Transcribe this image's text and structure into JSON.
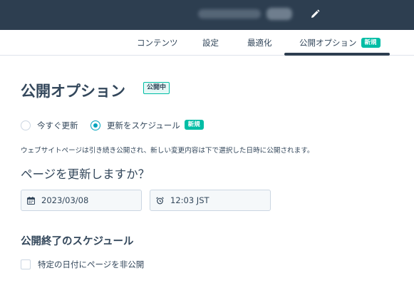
{
  "colors": {
    "topbar": "#2d3e50",
    "accent_teal": "#00bda5",
    "radio_selected": "#00a4bd",
    "text": "#33475b",
    "border": "#cbd6e2",
    "field_bg": "#f5f8fa"
  },
  "header": {
    "edit_icon": "pencil-icon"
  },
  "tabs": [
    {
      "label": "コンテンツ"
    },
    {
      "label": "設定"
    },
    {
      "label": "最適化"
    },
    {
      "label": "公開オプション",
      "badge": "新規",
      "active": true
    }
  ],
  "main": {
    "title": "公開オプション",
    "status_badge": "公開中",
    "publish_options": [
      {
        "label": "今すぐ更新",
        "selected": false
      },
      {
        "label": "更新をスケジュール",
        "selected": true,
        "badge": "新規"
      }
    ],
    "description": "ウェブサイトページは引き続き公開され、新しい変更内容は下で選択した日時に公開されます。",
    "question": "ページを更新しますか？",
    "date": {
      "value": "2023/03/08",
      "icon": "calendar-icon"
    },
    "time": {
      "value": "12:03 JST",
      "icon": "alarm-clock-icon"
    },
    "unpublish_section_title": "公開終了のスケジュール",
    "unpublish_checkbox": {
      "label": "特定の日付にページを非公開",
      "checked": false
    }
  }
}
